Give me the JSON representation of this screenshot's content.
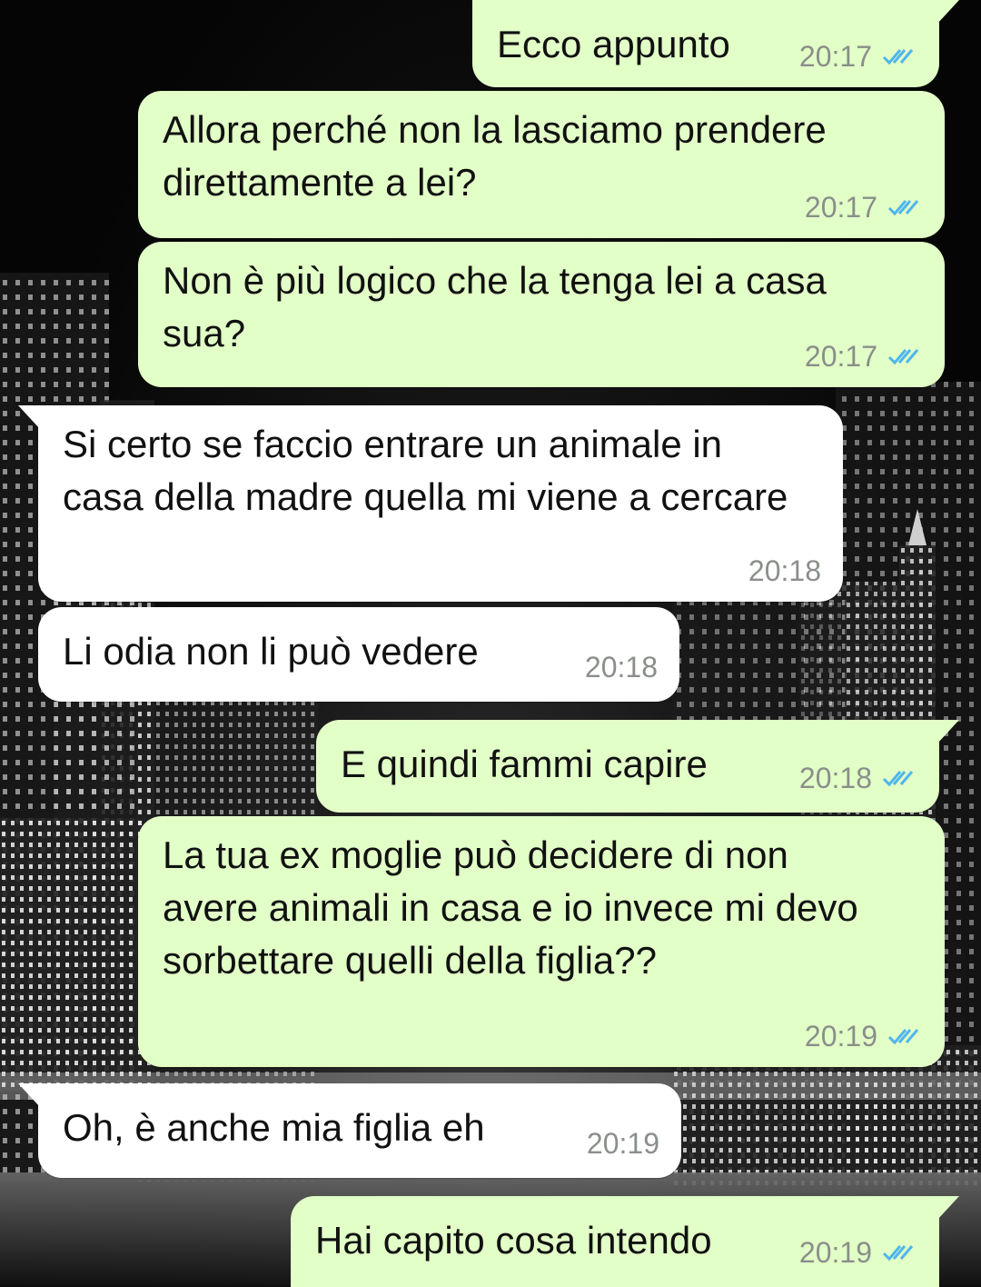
{
  "conversation": {
    "messages": [
      {
        "id": "m1",
        "direction": "outgoing",
        "text": "Ecco appunto",
        "time": "20:17",
        "status_icon": "double-check-read-icon"
      },
      {
        "id": "m2",
        "direction": "outgoing",
        "text": "Allora perché non la lasciamo prendere direttamente a lei?",
        "time": "20:17",
        "status_icon": "double-check-read-icon"
      },
      {
        "id": "m3",
        "direction": "outgoing",
        "text": "Non è più logico che la tenga lei a casa sua?",
        "time": "20:17",
        "status_icon": "double-check-read-icon"
      },
      {
        "id": "m4",
        "direction": "incoming",
        "text": "Si certo se faccio entrare un animale in casa della madre quella mi viene a cercare",
        "time": "20:18"
      },
      {
        "id": "m5",
        "direction": "incoming",
        "text": "Li odia non li può vedere",
        "time": "20:18"
      },
      {
        "id": "m6",
        "direction": "outgoing",
        "text": "E quindi fammi capire",
        "time": "20:18",
        "status_icon": "double-check-read-icon"
      },
      {
        "id": "m7",
        "direction": "outgoing",
        "text": "La tua ex moglie può decidere di non avere animali in casa e io invece mi devo sorbettare quelli della figlia??",
        "time": "20:19",
        "status_icon": "double-check-read-icon"
      },
      {
        "id": "m8",
        "direction": "incoming",
        "text": "Oh, è anche mia figlia eh",
        "time": "20:19"
      },
      {
        "id": "m9",
        "direction": "outgoing",
        "text": "Hai capito cosa intendo",
        "time": "20:19",
        "status_icon": "double-check-read-icon"
      }
    ]
  },
  "colors": {
    "outgoing_bubble": "#e2ffc7",
    "incoming_bubble": "#ffffff",
    "read_check": "#4fb6ec",
    "timestamp": "#8a8f8a",
    "wallpaper": "#0b0b0b"
  }
}
